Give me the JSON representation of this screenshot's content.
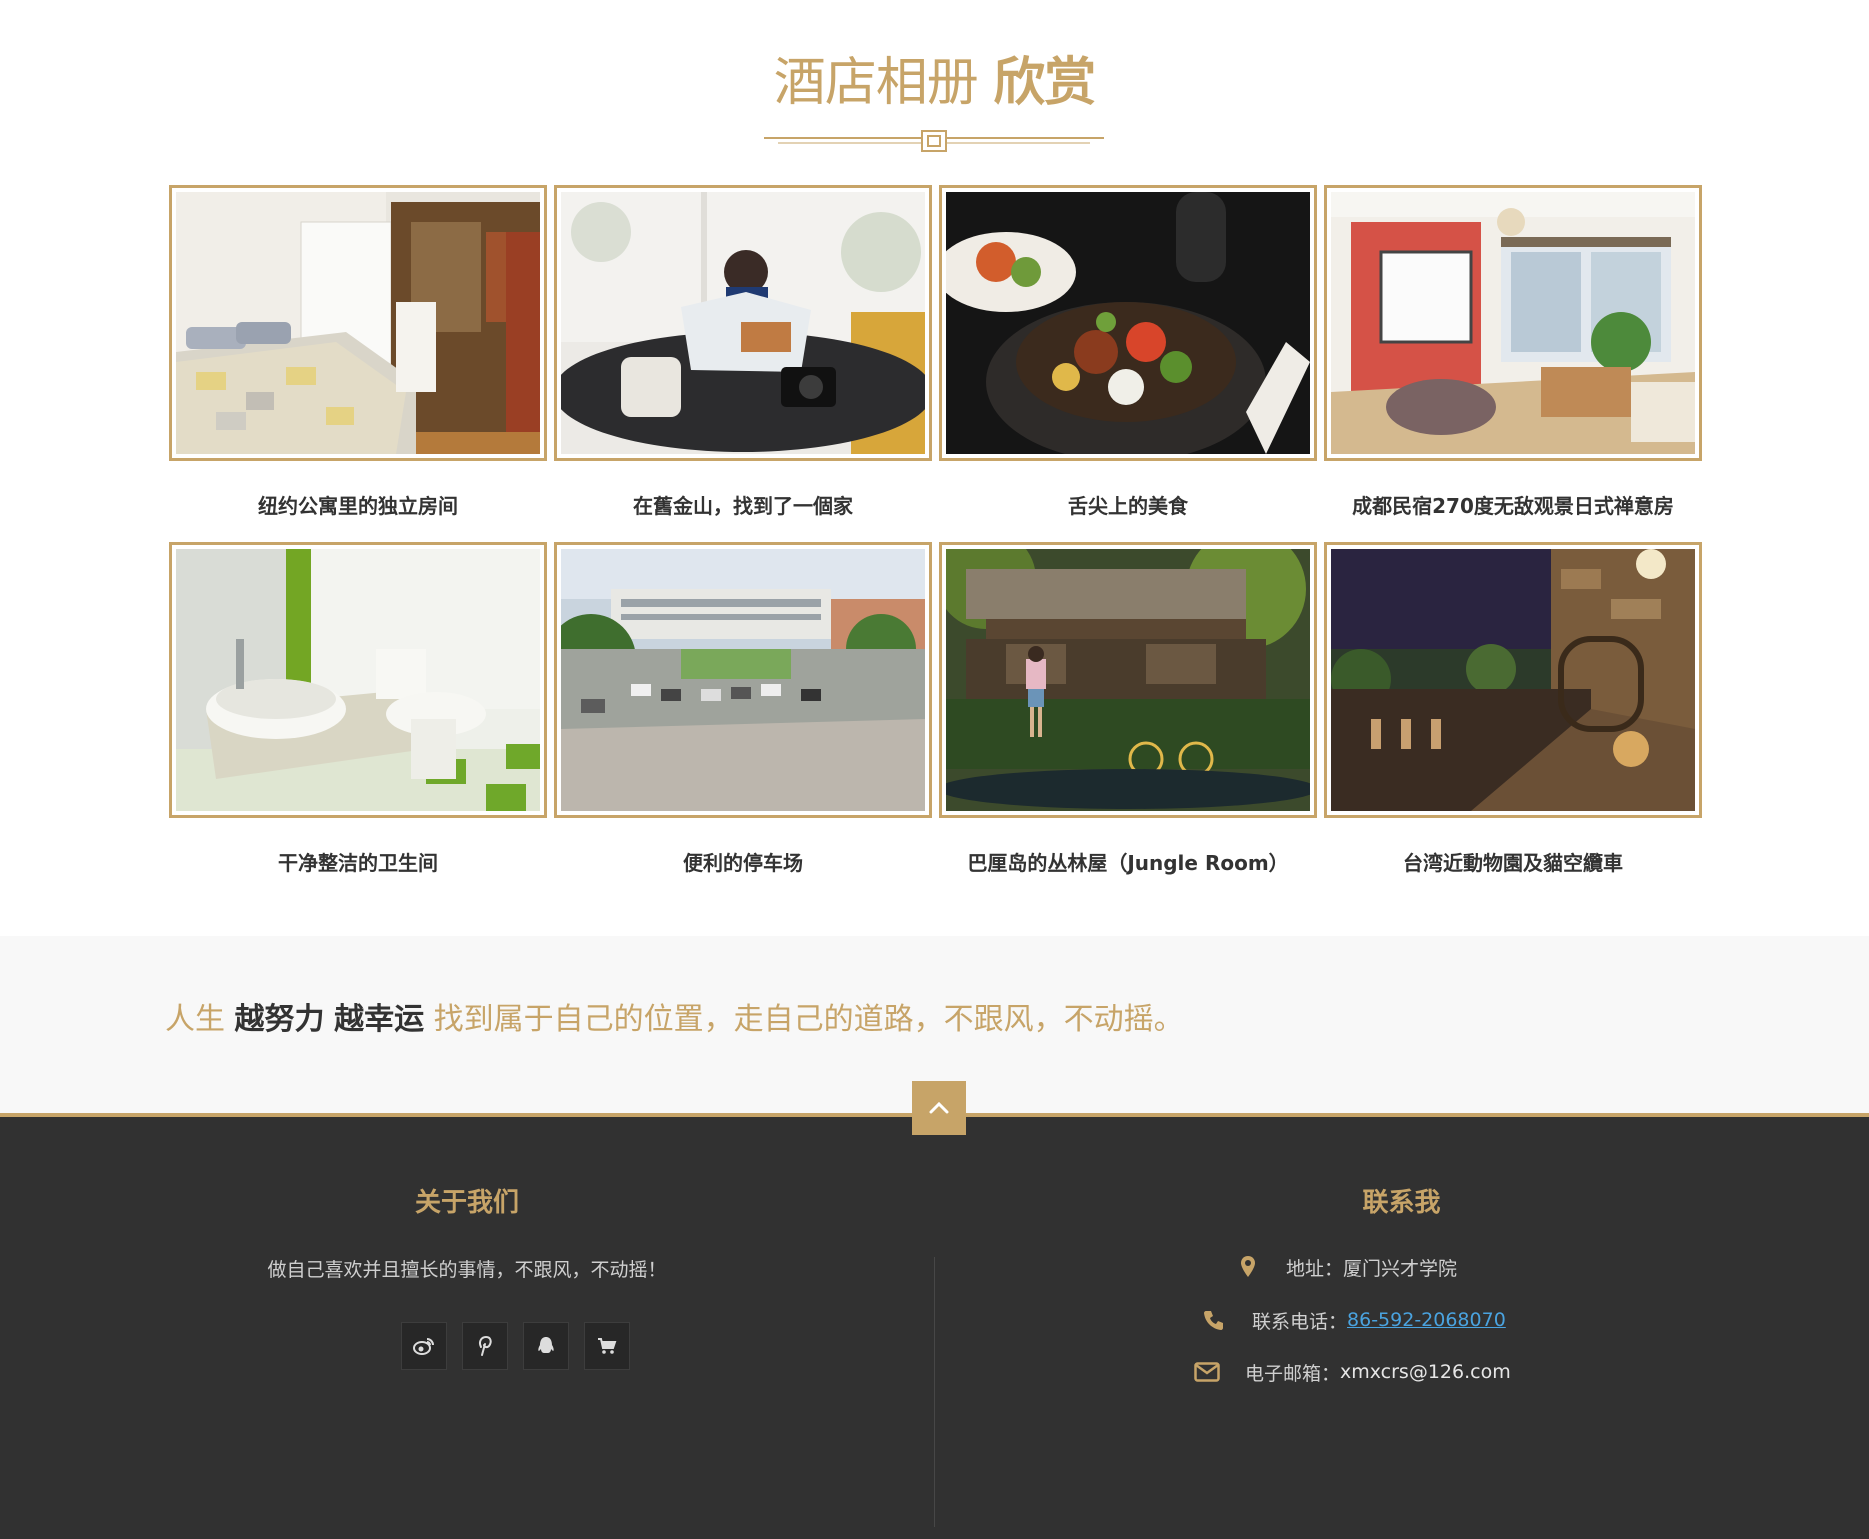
{
  "gallery": {
    "title_light": "酒店相册",
    "title_bold": "欣赏",
    "items": [
      {
        "caption": "纽约公寓里的独立房间",
        "image": "bedroom"
      },
      {
        "caption": "在舊金山，找到了一個家",
        "image": "cafe-reading"
      },
      {
        "caption": "舌尖上的美食",
        "image": "food-bowl"
      },
      {
        "caption": "成都民宿270度无敌观景日式禅意房",
        "image": "living-room"
      },
      {
        "caption": "干净整洁的卫生间",
        "image": "bathroom"
      },
      {
        "caption": "便利的停车场",
        "image": "parking-lot"
      },
      {
        "caption": "巴厘岛的丛林屋（Jungle Room）",
        "image": "jungle-house"
      },
      {
        "caption": "台湾近動物園及貓空纜車",
        "image": "night-balcony"
      }
    ]
  },
  "motto": {
    "prefix": "人生 ",
    "bold1": "越努力",
    "bold2": "越幸运",
    "suffix": " 找到属于自己的位置，走自己的道路，不跟风，不动摇。"
  },
  "footer": {
    "about": {
      "heading": "关于我们",
      "text": "做自己喜欢并且擅长的事情，不跟风，不动摇！",
      "socials": [
        "weibo-icon",
        "pinterest-icon",
        "qq-icon",
        "cart-icon"
      ]
    },
    "contact": {
      "heading": "联系我",
      "address_label": "地址：",
      "address": "厦门兴才学院",
      "phone_label": "联系电话：",
      "phone": "86-592-2068070",
      "email_label": "电子邮箱：",
      "email": "xmxcrs@126.com"
    }
  },
  "colors": {
    "accent": "#c7a468",
    "footer_bg": "#313131",
    "band_bg": "#f8f8f8",
    "text_dark": "#333333",
    "link": "#4aa3df"
  }
}
